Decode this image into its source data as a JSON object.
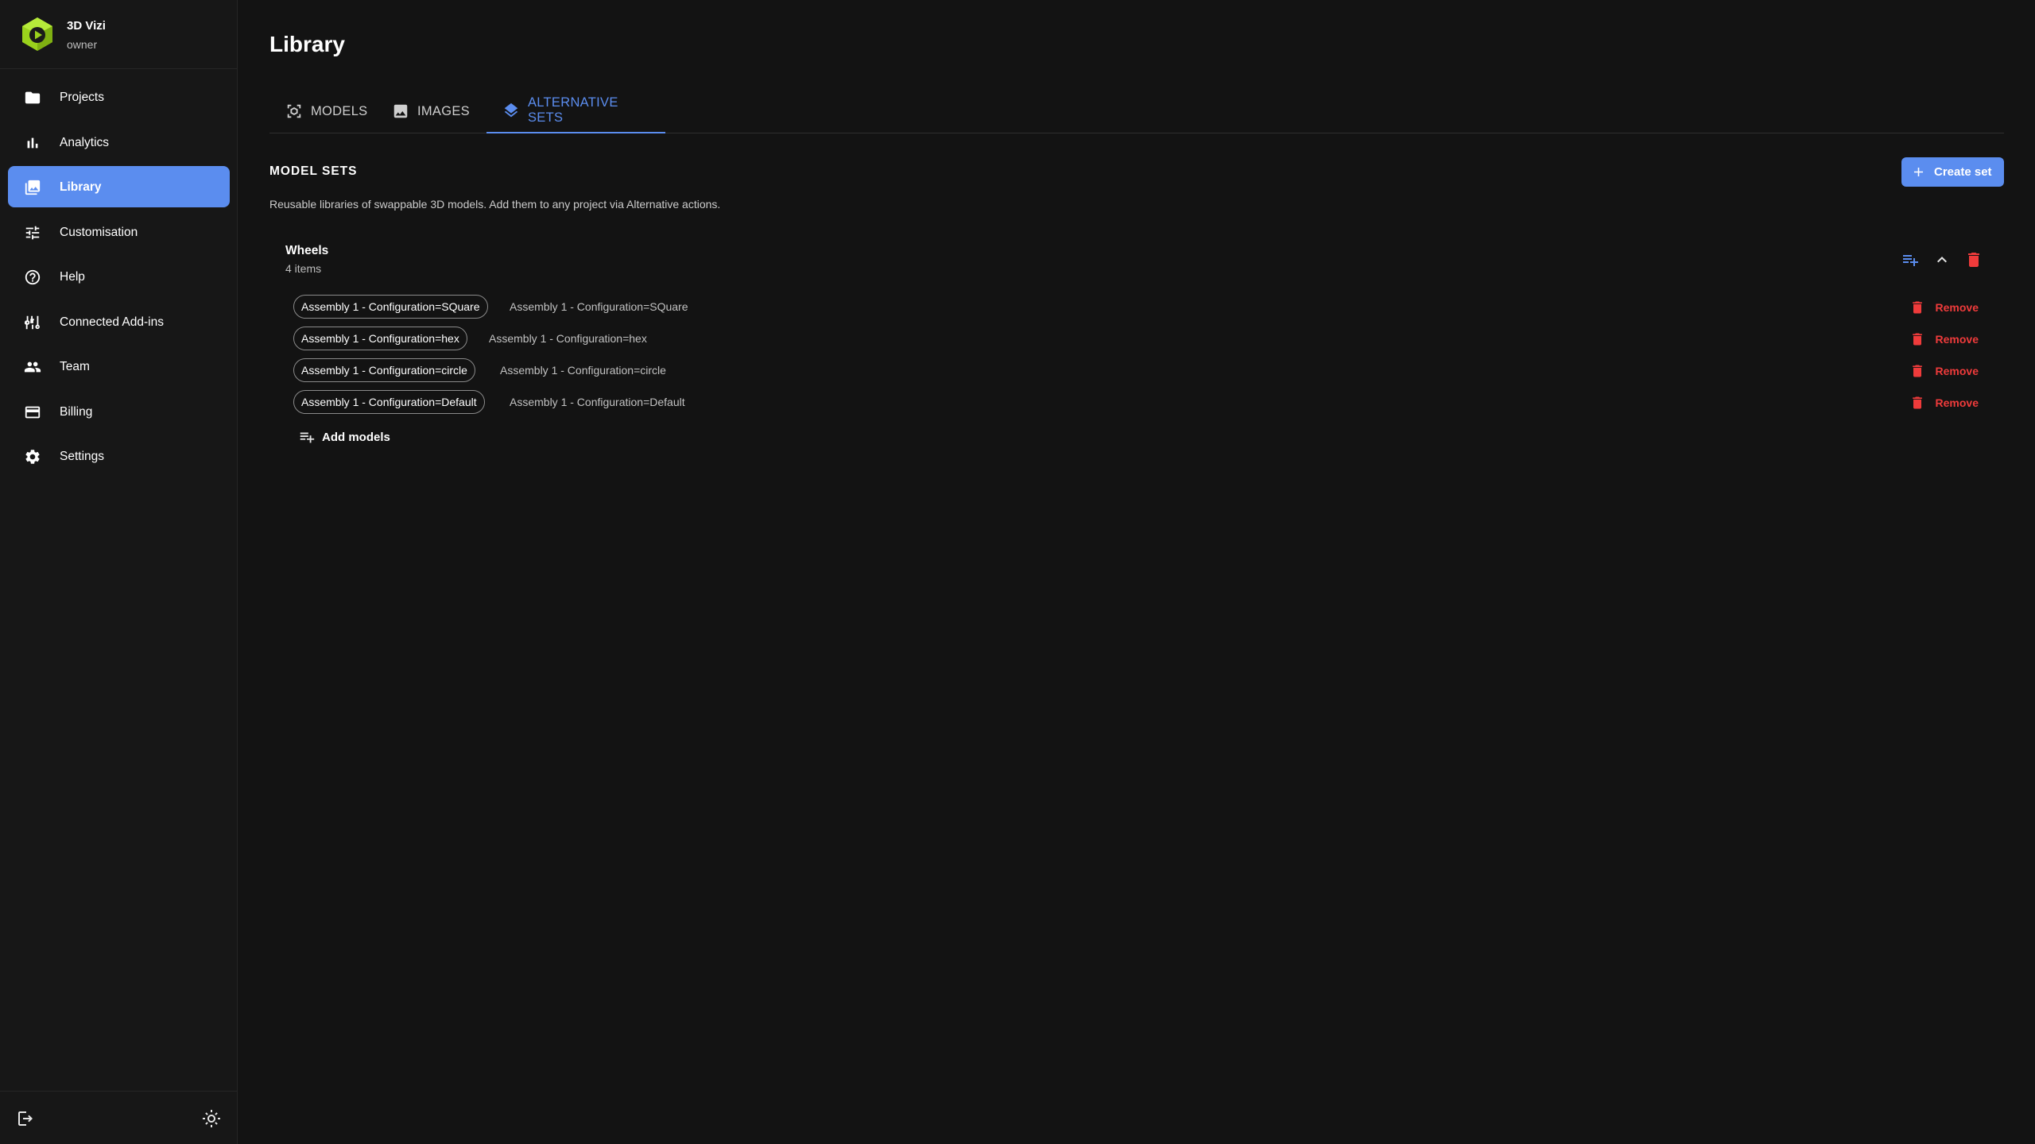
{
  "brand": {
    "name": "3D Vizi",
    "role": "owner",
    "logo_icon": "hexagon-play-logo",
    "logo_color": "#9ad21c"
  },
  "sidebar": {
    "items": [
      {
        "label": "Projects",
        "icon": "folder-icon",
        "active": false
      },
      {
        "label": "Analytics",
        "icon": "bar-chart-icon",
        "active": false
      },
      {
        "label": "Library",
        "icon": "photo-library-icon",
        "active": true
      },
      {
        "label": "Customisation",
        "icon": "tune-icon",
        "active": false
      },
      {
        "label": "Help",
        "icon": "help-circle-icon",
        "active": false
      },
      {
        "label": "Connected Add-ins",
        "icon": "add-ins-icon",
        "active": false
      },
      {
        "label": "Team",
        "icon": "people-icon",
        "active": false
      },
      {
        "label": "Billing",
        "icon": "credit-card-icon",
        "active": false
      },
      {
        "label": "Settings",
        "icon": "gear-icon",
        "active": false
      }
    ],
    "footer": {
      "logout_icon": "logout-icon",
      "theme_icon": "sun-icon"
    }
  },
  "page": {
    "title": "Library"
  },
  "tabs": [
    {
      "label": "MODELS",
      "icon": "model-icon",
      "active": false
    },
    {
      "label": "IMAGES",
      "icon": "image-icon",
      "active": false
    },
    {
      "label": "ALTERNATIVE SETS",
      "icon": "layers-icon",
      "active": true
    }
  ],
  "section": {
    "title": "MODEL SETS",
    "description": "Reusable libraries of swappable 3D models. Add them to any project via Alternative actions.",
    "create_label": "Create set"
  },
  "set": {
    "name": "Wheels",
    "count": "4 items",
    "items": [
      {
        "chip": "Assembly 1 - Configuration=SQuare",
        "description": "Assembly 1 - Configuration=SQuare",
        "remove": "Remove"
      },
      {
        "chip": "Assembly 1 - Configuration=hex",
        "description": "Assembly 1 - Configuration=hex",
        "remove": "Remove"
      },
      {
        "chip": "Assembly 1 - Configuration=circle",
        "description": "Assembly 1 - Configuration=circle",
        "remove": "Remove"
      },
      {
        "chip": "Assembly 1 - Configuration=Default",
        "description": "Assembly 1 - Configuration=Default",
        "remove": "Remove"
      }
    ],
    "add_models_label": "Add models"
  },
  "colors": {
    "accent": "#5b8def",
    "danger": "#ef3b3b",
    "background": "#131313",
    "sidebar": "#171717"
  }
}
